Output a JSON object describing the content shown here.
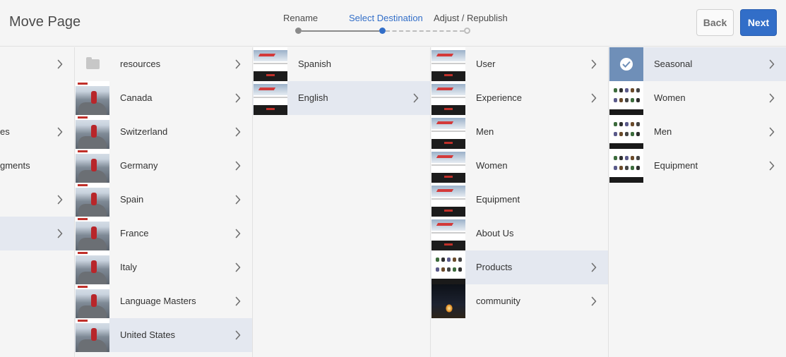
{
  "header": {
    "title": "Move Page",
    "back_label": "Back",
    "next_label": "Next"
  },
  "wizard": {
    "steps": [
      {
        "label": "Rename",
        "state": "done"
      },
      {
        "label": "Select Destination",
        "state": "active"
      },
      {
        "label": "Adjust / Republish",
        "state": "todo"
      }
    ]
  },
  "colors": {
    "accent": "#326ec8",
    "selected_row": "#e4e8f0"
  },
  "columns": [
    {
      "rows": [
        {
          "label": "",
          "thumb": "none",
          "has_children": true,
          "selected": false
        },
        {
          "label": "",
          "thumb": "none",
          "has_children": false,
          "selected": false
        },
        {
          "label": "es",
          "thumb": "none",
          "has_children": true,
          "selected": false
        },
        {
          "label": "gments",
          "thumb": "none",
          "has_children": false,
          "selected": false
        },
        {
          "label": "",
          "thumb": "none",
          "has_children": true,
          "selected": false
        },
        {
          "label": "",
          "thumb": "none",
          "has_children": true,
          "selected": true
        }
      ]
    },
    {
      "rows": [
        {
          "label": "resources",
          "thumb": "folder",
          "has_children": true,
          "selected": false
        },
        {
          "label": "Canada",
          "thumb": "hiker",
          "has_children": true,
          "selected": false
        },
        {
          "label": "Switzerland",
          "thumb": "hiker",
          "has_children": true,
          "selected": false
        },
        {
          "label": "Germany",
          "thumb": "hiker",
          "has_children": true,
          "selected": false
        },
        {
          "label": "Spain",
          "thumb": "hiker",
          "has_children": true,
          "selected": false
        },
        {
          "label": "France",
          "thumb": "hiker",
          "has_children": true,
          "selected": false
        },
        {
          "label": "Italy",
          "thumb": "hiker",
          "has_children": true,
          "selected": false
        },
        {
          "label": "Language Masters",
          "thumb": "hiker",
          "has_children": true,
          "selected": false
        },
        {
          "label": "United States",
          "thumb": "hiker",
          "has_children": true,
          "selected": true
        }
      ]
    },
    {
      "rows": [
        {
          "label": "Spanish",
          "thumb": "site",
          "has_children": false,
          "selected": false
        },
        {
          "label": "English",
          "thumb": "site",
          "has_children": true,
          "selected": true
        }
      ]
    },
    {
      "rows": [
        {
          "label": "User",
          "thumb": "site",
          "has_children": true,
          "selected": false
        },
        {
          "label": "Experience",
          "thumb": "site",
          "has_children": true,
          "selected": false
        },
        {
          "label": "Men",
          "thumb": "site",
          "has_children": false,
          "selected": false
        },
        {
          "label": "Women",
          "thumb": "site",
          "has_children": false,
          "selected": false
        },
        {
          "label": "Equipment",
          "thumb": "site",
          "has_children": false,
          "selected": false
        },
        {
          "label": "About Us",
          "thumb": "site",
          "has_children": false,
          "selected": false
        },
        {
          "label": "Products",
          "thumb": "products",
          "has_children": true,
          "selected": true
        },
        {
          "label": "community",
          "thumb": "night",
          "has_children": true,
          "selected": false
        }
      ]
    },
    {
      "rows": [
        {
          "label": "Seasonal",
          "thumb": "seasonal",
          "has_children": true,
          "selected": true,
          "checked": true
        },
        {
          "label": "Women",
          "thumb": "products",
          "has_children": true,
          "selected": false
        },
        {
          "label": "Men",
          "thumb": "products",
          "has_children": true,
          "selected": false
        },
        {
          "label": "Equipment",
          "thumb": "products",
          "has_children": true,
          "selected": false
        }
      ]
    }
  ]
}
